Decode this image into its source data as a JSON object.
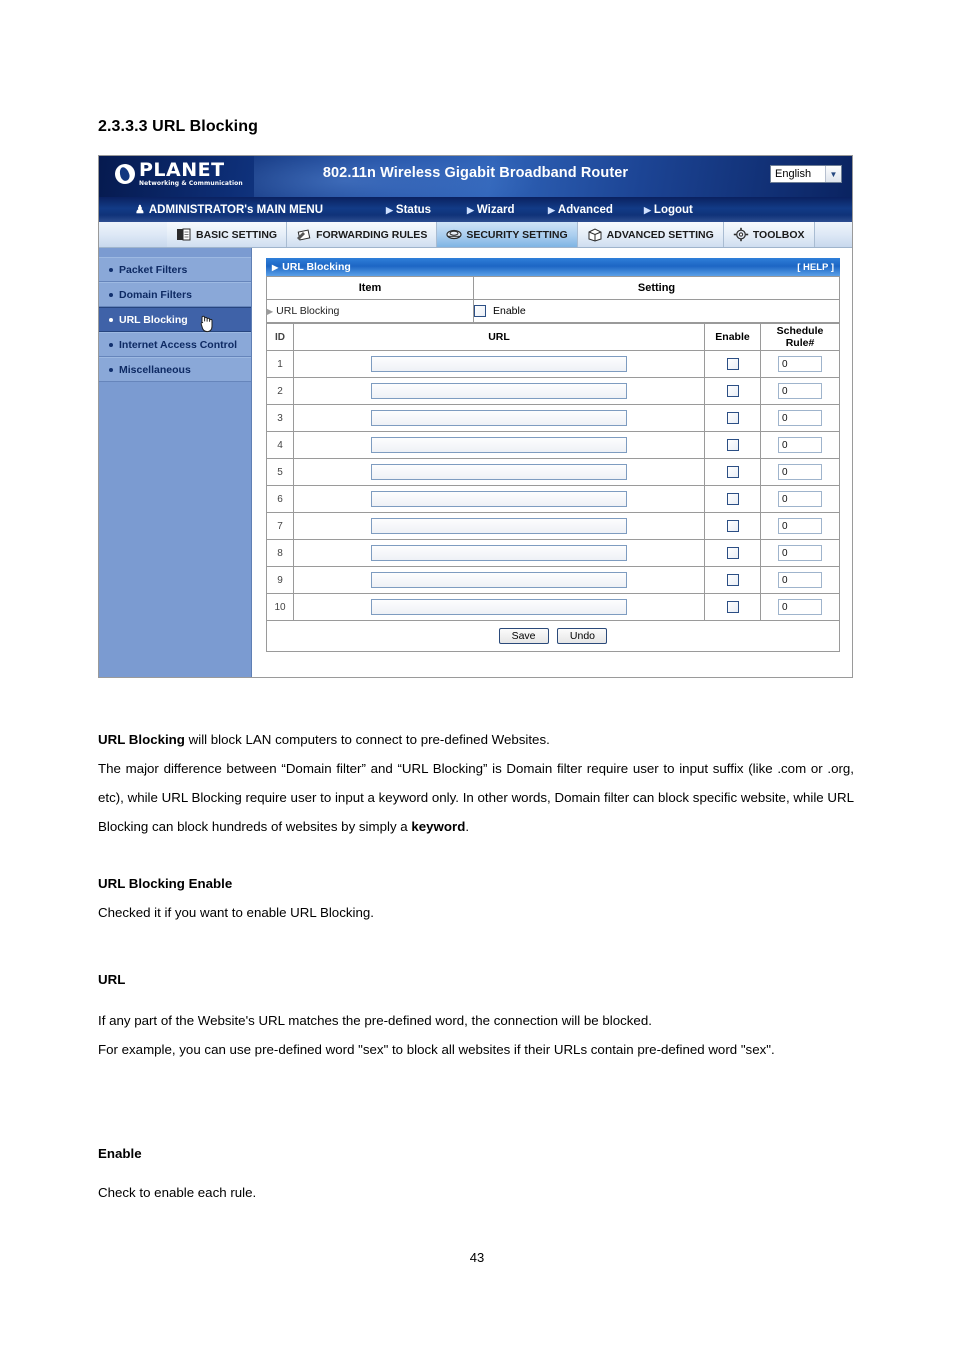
{
  "document": {
    "heading": "2.3.3.3 URL Blocking",
    "page_number": "43",
    "paragraphs": {
      "intro_bold": "URL Blocking",
      "intro_rest": " will block LAN computers to connect to pre-defined Websites.",
      "intro_line2_a": "The major difference between “Domain filter” and “URL Blocking” is Domain filter require user to input suffix (like .com or .org, etc), while URL Blocking require user to input a keyword only. In other words, Domain filter can block specific website, while URL Blocking can block hundreds of websites by simply a ",
      "intro_line2_bold": "keyword",
      "intro_line2_end": ".",
      "h_url_blocking_enable": "URL Blocking Enable",
      "t_url_blocking_enable": "Checked it if you want to enable URL Blocking.",
      "h_url": "URL",
      "t_url_1": "If any part of the Website's URL matches the pre-defined word, the connection will be blocked.",
      "t_url_2": "For example, you can use pre-defined word \"sex\" to block all websites if their URLs contain pre-defined word \"sex\".",
      "h_enable": "Enable",
      "t_enable": "Check to enable each rule."
    }
  },
  "router_ui": {
    "banner": {
      "brand_name": "PLANET",
      "brand_tagline": "Networking & Communication",
      "product_title": "802.11n Wireless Gigabit Broadband Router",
      "language_selected": "English"
    },
    "main_menu": {
      "admin_label": "ADMINISTRATOR's MAIN MENU",
      "items": [
        {
          "label": "Status"
        },
        {
          "label": "Wizard"
        },
        {
          "label": "Advanced"
        },
        {
          "label": "Logout"
        }
      ]
    },
    "tabs": [
      {
        "label": "BASIC SETTING",
        "icon": "book-icon",
        "active": false
      },
      {
        "label": "FORWARDING RULES",
        "icon": "forwarding-icon",
        "active": false
      },
      {
        "label": "SECURITY SETTING",
        "icon": "shield-icon",
        "active": true
      },
      {
        "label": "ADVANCED SETTING",
        "icon": "box-icon",
        "active": false
      },
      {
        "label": "TOOLBOX",
        "icon": "toolbox-icon",
        "active": false
      }
    ],
    "sidebar": {
      "items": [
        {
          "label": "Packet Filters",
          "selected": false
        },
        {
          "label": "Domain Filters",
          "selected": false
        },
        {
          "label": "URL Blocking",
          "selected": true
        },
        {
          "label": "Internet Access Control",
          "selected": false
        },
        {
          "label": "Miscellaneous",
          "selected": false
        }
      ]
    },
    "panel": {
      "title": "URL Blocking",
      "help_label": "[ HELP ]",
      "setting_header": {
        "item": "Item",
        "setting": "Setting"
      },
      "setting_row": {
        "item": "URL Blocking",
        "enable_label": "Enable",
        "enable_checked": false
      },
      "table_headers": {
        "id": "ID",
        "url": "URL",
        "enable": "Enable",
        "schedule": "Schedule Rule#"
      },
      "rows": [
        {
          "id": "1",
          "url": "",
          "enable": false,
          "schedule": "0"
        },
        {
          "id": "2",
          "url": "",
          "enable": false,
          "schedule": "0"
        },
        {
          "id": "3",
          "url": "",
          "enable": false,
          "schedule": "0"
        },
        {
          "id": "4",
          "url": "",
          "enable": false,
          "schedule": "0"
        },
        {
          "id": "5",
          "url": "",
          "enable": false,
          "schedule": "0"
        },
        {
          "id": "6",
          "url": "",
          "enable": false,
          "schedule": "0"
        },
        {
          "id": "7",
          "url": "",
          "enable": false,
          "schedule": "0"
        },
        {
          "id": "8",
          "url": "",
          "enable": false,
          "schedule": "0"
        },
        {
          "id": "9",
          "url": "",
          "enable": false,
          "schedule": "0"
        },
        {
          "id": "10",
          "url": "",
          "enable": false,
          "schedule": "0"
        }
      ],
      "buttons": {
        "save": "Save",
        "undo": "Undo"
      }
    }
  }
}
